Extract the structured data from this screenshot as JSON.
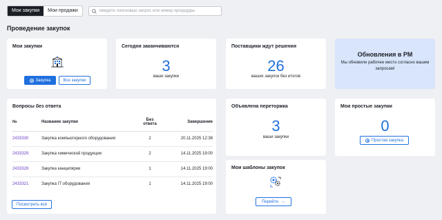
{
  "tabs": [
    {
      "label": "Мои закупки",
      "active": true
    },
    {
      "label": "Мои продажи",
      "active": false
    }
  ],
  "search": {
    "placeholder": "Введите поисковый запрос или номер процедуры"
  },
  "page_title": "Проведение закупок",
  "my_purchases": {
    "title": "Мои закупки",
    "create_button": "Закупка",
    "all_button": "Все закупки"
  },
  "ending_today": {
    "title": "Сегодня заканчиваются",
    "count": "3",
    "caption": "ваши закупки"
  },
  "suppliers_waiting": {
    "title": "Поставщики ждут решения",
    "count": "26",
    "caption": "ваших закупок без итогов"
  },
  "updates": {
    "title": "Обновления в РМ",
    "text": "Мы обновили рабочее место согласно вашим запросам!"
  },
  "questions": {
    "title": "Вопросы без ответа",
    "columns": [
      "№",
      "Название закупки",
      "Без ответа",
      "Завершение"
    ],
    "rows": [
      {
        "num": "2433330",
        "name": "Закупка компьютерного оборудования",
        "count": "2",
        "end": "20.11.2025 12:38"
      },
      {
        "num": "2433329",
        "name": "Закупка химической продукции",
        "count": "2",
        "end": "14.11.2025 19:00"
      },
      {
        "num": "2433328",
        "name": "Закупка канцелярии",
        "count": "1",
        "end": "14.11.2025 19:00"
      },
      {
        "num": "2433321",
        "name": "Закупка IT оборудования",
        "count": "1",
        "end": "14.11.2025 19:00"
      }
    ],
    "view_all": "Посмотреть всё"
  },
  "rebidding": {
    "title": "Объявлена переторжка",
    "count": "3",
    "caption": "ваши закупки"
  },
  "simple_purchases": {
    "title": "Мои простые закупки",
    "count": "0",
    "button": "Простая закупка"
  },
  "templates": {
    "title": "Мои шаблоны закупок",
    "button": "Перейти"
  },
  "colors": {
    "accent": "#1f6fde",
    "link": "#6d3fc7",
    "update_bg": "#d8e5fb",
    "background": "#eef0f3"
  }
}
